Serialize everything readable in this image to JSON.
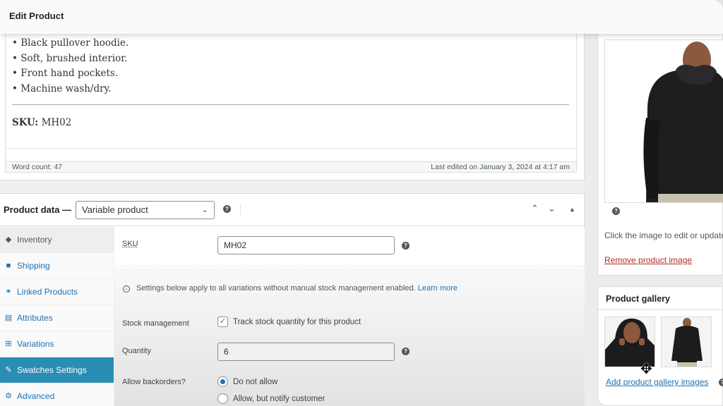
{
  "header": {
    "title": "Edit Product"
  },
  "editor": {
    "bullets": [
      "• Black pullover hoodie.",
      "• Soft, brushed interior.",
      "• Front hand pockets.",
      "• Machine wash/dry."
    ],
    "sku_label": "SKU:",
    "sku_value": "MH02",
    "word_count": "Word count: 47",
    "last_edited": "Last edited on January 3, 2024 at 4:17 am"
  },
  "product_data": {
    "label": "Product data —",
    "type_select": "Variable product",
    "help_icon": "question-circle-icon",
    "controls": {
      "up": "^",
      "down": "v",
      "toggle": "▲"
    },
    "tabs": [
      {
        "label": "Inventory",
        "icon": "tag-icon",
        "glyph": "◆"
      },
      {
        "label": "Shipping",
        "icon": "truck-icon",
        "glyph": "■"
      },
      {
        "label": "Linked Products",
        "icon": "link-icon",
        "glyph": "⚭"
      },
      {
        "label": "Attributes",
        "icon": "list-icon",
        "glyph": "▤"
      },
      {
        "label": "Variations",
        "icon": "grid-icon",
        "glyph": "⊞"
      },
      {
        "label": "Swatches Settings",
        "icon": "wrench-icon",
        "glyph": "✎",
        "active": true
      },
      {
        "label": "Advanced",
        "icon": "gear-icon",
        "glyph": "⚙"
      }
    ],
    "inventory": {
      "sku_label": "SKU",
      "sku_value": "MH02",
      "notice": "Settings below apply to all variations without manual stock management enabled.",
      "notice_link": "Learn more",
      "stock_management_label": "Stock management",
      "stock_management_checkbox": "Track stock quantity for this product",
      "stock_management_checked": true,
      "quantity_label": "Quantity",
      "quantity_value": "6",
      "backorders_label": "Allow backorders?",
      "backorder_options": [
        "Do not allow",
        "Allow, but notify customer"
      ],
      "backorder_selected": "Do not allow"
    }
  },
  "sidebar": {
    "product_image": {
      "help_icon": "question-circle-icon",
      "hint": "Click the image to edit or update",
      "remove_link": "Remove product image"
    },
    "gallery": {
      "title": "Product gallery",
      "add_link": "Add product gallery images"
    }
  },
  "colors": {
    "accent": "#2271b1",
    "active_tab": "#2a8db3",
    "danger": "#b32d2e"
  }
}
